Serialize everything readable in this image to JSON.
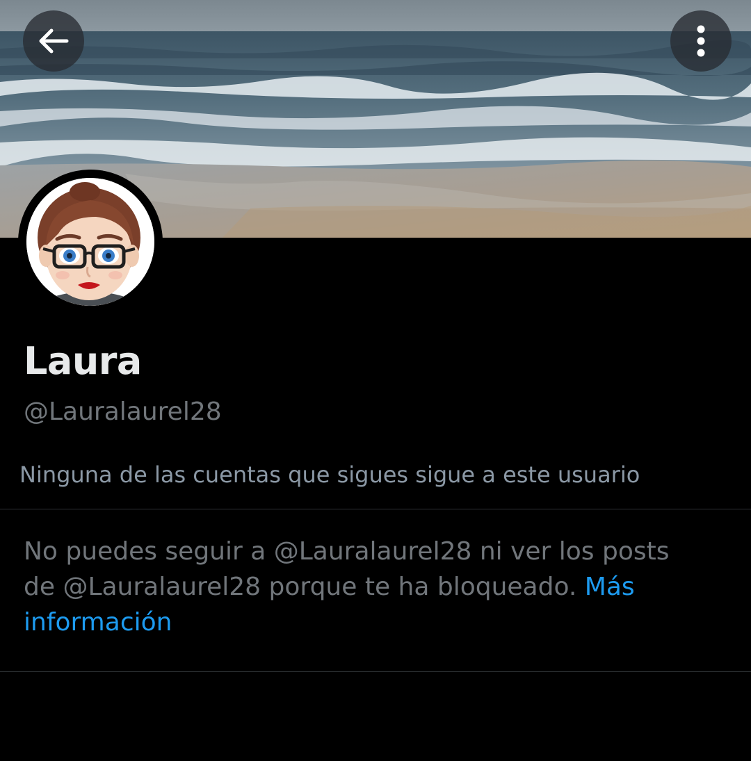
{
  "header": {
    "back_icon": "arrow-left-icon",
    "more_icon": "more-vertical-icon"
  },
  "banner": {
    "description_icon": "beach-banner-image"
  },
  "profile": {
    "avatar_icon": "bitmoji-avatar",
    "name": "Laura",
    "handle": "@Lauralaurel28",
    "followers_note": "Ninguna de las cuentas que sigues sigue a este usuario"
  },
  "blocked": {
    "message": "No puedes seguir a @Lauralaurel28 ni ver los posts de @Lauralaurel28 porque te ha bloqueado.",
    "link_label": "Más información"
  },
  "colors": {
    "background": "#000000",
    "primary_text": "#e7e9ea",
    "secondary_text": "#71767b",
    "link": "#1d9bf0",
    "divider": "#2f3336"
  }
}
